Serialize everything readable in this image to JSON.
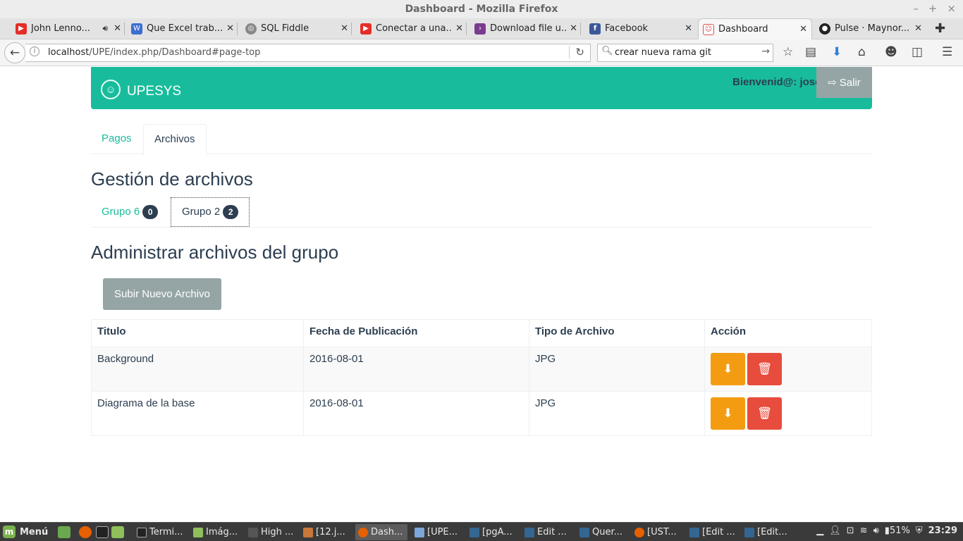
{
  "window": {
    "title": "Dashboard - Mozilla Firefox"
  },
  "window_buttons": [
    "–",
    "+",
    "×"
  ],
  "browser_tabs": [
    {
      "label": "John Lenno...",
      "favicon": "youtube-icon",
      "color": "#e52d27",
      "muted": true
    },
    {
      "label": "Que Excel trab...",
      "favicon": "page-icon",
      "color": "#3b6fd1"
    },
    {
      "label": "SQL Fiddle",
      "favicon": "sqlfiddle-icon",
      "color": "#777777"
    },
    {
      "label": "Conectar a una...",
      "favicon": "youtube-icon",
      "color": "#e52d27"
    },
    {
      "label": "Download file u...",
      "favicon": "video-icon",
      "color": "#7a3b8f"
    },
    {
      "label": "Facebook",
      "favicon": "facebook-icon",
      "color": "#3b5998"
    },
    {
      "label": "Dashboard",
      "favicon": "upesys-icon",
      "color": "#d9534f",
      "active": true
    },
    {
      "label": "Pulse · Maynor...",
      "favicon": "github-icon",
      "color": "#222222"
    }
  ],
  "nav": {
    "url_host": "localhost",
    "url_path": "/UPE/index.php/Dashboard#page-top",
    "search_value": "crear nueva rama git"
  },
  "brand": {
    "name": "UPESYS",
    "welcome": "Bienvenid@: jose",
    "logout_label": "Salir",
    "accent": "#18bc9c"
  },
  "main_tabs": [
    {
      "label": "Pagos",
      "active": false
    },
    {
      "label": "Archivos",
      "active": true
    }
  ],
  "section_title": "Gestión de archivos",
  "group_tabs": [
    {
      "label": "Grupo 6",
      "count": "0",
      "active": false
    },
    {
      "label": "Grupo 2",
      "count": "2",
      "active": true
    }
  ],
  "admin_title": "Administrar archivos del grupo",
  "upload_label": "Subir Nuevo Archivo",
  "table": {
    "headers": [
      "Titulo",
      "Fecha de Publicación",
      "Tipo de Archivo",
      "Acción"
    ],
    "rows": [
      {
        "title": "Background",
        "date": "2016-08-01",
        "type": "JPG"
      },
      {
        "title": "Diagrama de la base",
        "date": "2016-08-01",
        "type": "JPG"
      }
    ]
  },
  "taskbar": {
    "menu_label": "Menú",
    "items": [
      {
        "label": "Termi...",
        "active": false
      },
      {
        "label": "Imág...",
        "active": false
      },
      {
        "label": "High ...",
        "active": false
      },
      {
        "label": "[12.j...",
        "active": false
      },
      {
        "label": "Dash...",
        "active": true
      },
      {
        "label": "[UPE...",
        "active": false
      },
      {
        "label": "[pgA...",
        "active": false
      },
      {
        "label": "Edit ...",
        "active": false
      },
      {
        "label": "Quer...",
        "active": false
      },
      {
        "label": "[UST...",
        "active": false
      },
      {
        "label": "[Edit ...",
        "active": false
      },
      {
        "label": "[Edit...",
        "active": false
      }
    ],
    "battery": "51%",
    "clock": "23:29"
  }
}
